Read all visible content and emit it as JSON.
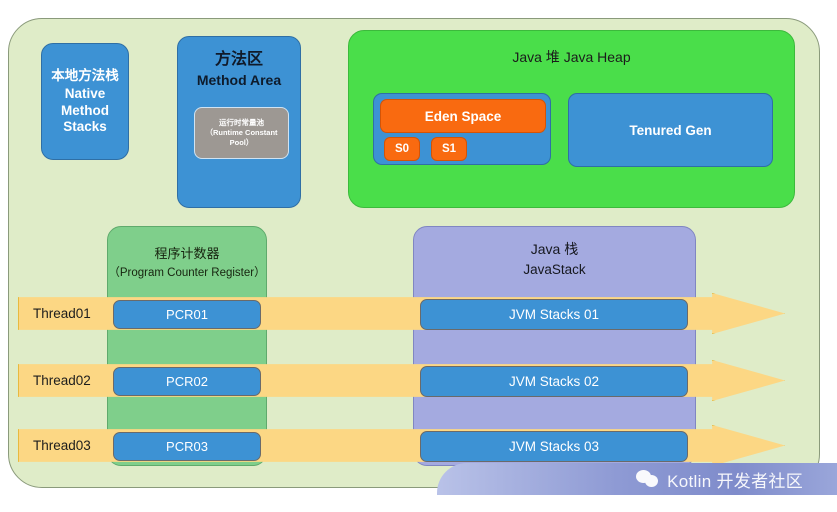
{
  "diagram": {
    "runtime_area": {
      "native_method_stacks": {
        "cn": "本地方法栈",
        "line1": "Native",
        "line2": "Method",
        "line3": "Stacks"
      },
      "method_area": {
        "cn": "方法区",
        "en": "Method Area",
        "runtime_constant_pool": {
          "cn": "运行时常量池",
          "en": "（Runtime Constant",
          "en2": "Pool）"
        }
      },
      "heap": {
        "title": "Java 堆  Java Heap",
        "eden": "Eden Space",
        "survivor0": "S0",
        "survivor1": "S1",
        "tenured": "Tenured Gen"
      },
      "program_counter": {
        "cn": "程序计数器",
        "en": "（Program Counter Register）"
      },
      "java_stack": {
        "cn": "Java 栈",
        "en": "JavaStack"
      },
      "threads": [
        {
          "label": "Thread01",
          "pcr": "PCR01",
          "jvm_stack": "JVM Stacks 01"
        },
        {
          "label": "Thread02",
          "pcr": "PCR02",
          "jvm_stack": "JVM Stacks 02"
        },
        {
          "label": "Thread03",
          "pcr": "PCR03",
          "jvm_stack": "JVM Stacks 03"
        }
      ]
    },
    "watermark": {
      "text": "Kotlin 开发者社区",
      "icon": "wechat-icon"
    },
    "colors": {
      "outer_background": "#dfecc8",
      "blue_box": "#3d92d4",
      "heap_green": "#4ade4a",
      "eden_orange": "#f96a10",
      "pcr_column_green": "#7fcf8b",
      "stack_column_purple": "#a4aae0",
      "thread_arrow_yellow": "#fcd784",
      "constant_pool_gray": "#9d9893"
    }
  }
}
